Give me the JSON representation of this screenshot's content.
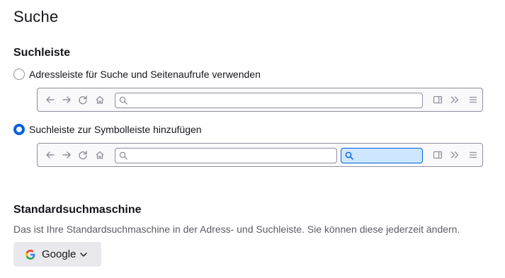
{
  "page": {
    "title": "Suche"
  },
  "searchbar_section": {
    "heading": "Suchleiste",
    "options": [
      {
        "label": "Adressleiste für Suche und Seitenaufrufe verwenden",
        "checked": false
      },
      {
        "label": "Suchleiste zur Symbolleiste hinzufügen",
        "checked": true
      }
    ]
  },
  "default_engine_section": {
    "heading": "Standardsuchmaschine",
    "description": "Das ist Ihre Standardsuchmaschine in der Adress- und Suchleiste. Sie können diese jederzeit ändern.",
    "engine": {
      "selected": "Google",
      "icon": "google-icon"
    }
  },
  "icons": {
    "back": "arrow-left-icon",
    "forward": "arrow-right-icon",
    "reload": "reload-icon",
    "home": "home-icon",
    "search": "magnifier-icon",
    "sidebar": "sidebar-icon",
    "overflow": "double-chevron-icon",
    "menu": "hamburger-menu-icon"
  },
  "colors": {
    "accent": "#0061e0",
    "search_highlight": "#cfe6ff",
    "button_bg": "#e9e9ed",
    "muted_text": "#5b5b66"
  }
}
